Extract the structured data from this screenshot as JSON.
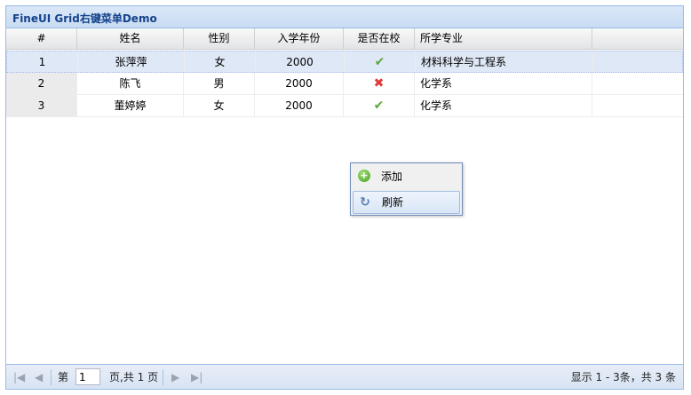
{
  "panel": {
    "title": "FineUI Grid右键菜单Demo"
  },
  "grid": {
    "columns": [
      "#",
      "姓名",
      "性别",
      "入学年份",
      "是否在校",
      "所学专业",
      ""
    ],
    "rows": [
      {
        "index": "1",
        "name": "张萍萍",
        "gender": "女",
        "year": "2000",
        "in_school_icon": "check-icon",
        "major": "材料科学与工程系"
      },
      {
        "index": "2",
        "name": "陈飞",
        "gender": "男",
        "year": "2000",
        "in_school_icon": "cross-icon",
        "major": "化学系"
      },
      {
        "index": "3",
        "name": "董婷婷",
        "gender": "女",
        "year": "2000",
        "in_school_icon": "check-icon",
        "major": "化学系"
      }
    ]
  },
  "context_menu": {
    "items": [
      {
        "label": "添加",
        "icon": "add-icon"
      },
      {
        "label": "刷新",
        "icon": "refresh-icon"
      }
    ]
  },
  "toolbar": {
    "page_prefix": "第",
    "page_value": "1",
    "page_suffix": "页,共 1 页",
    "info": "显示 1 - 3条，共 3 条",
    "icons": [
      "first-page-icon",
      "prev-page-icon",
      "next-page-icon",
      "last-page-icon"
    ]
  },
  "colors": {
    "header_title": "#15428b",
    "selected_row": "#dfe8f6",
    "check": "#5aa73a",
    "cross": "#e03a3a"
  }
}
